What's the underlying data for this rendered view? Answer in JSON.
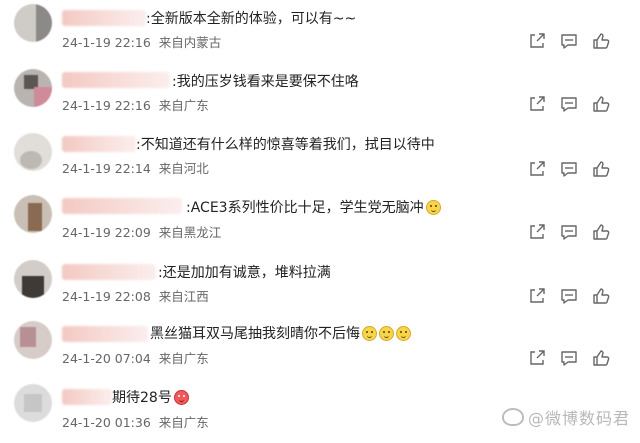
{
  "comments": [
    {
      "text": ":全新版本全新的体验，可以有~~",
      "date": "24-1-19 22:16",
      "source": "来自内蒙古",
      "emojis": []
    },
    {
      "text": ":我的压岁钱看来是要保不住咯",
      "date": "24-1-19 22:16",
      "source": "来自广东",
      "emojis": []
    },
    {
      "text": ":不知道还有什么样的惊喜等着我们，拭目以待中",
      "date": "24-1-19 22:14",
      "source": "来自河北",
      "emojis": []
    },
    {
      "text": ":ACE3系列性价比十足，学生党无脑冲",
      "date": "24-1-19 22:09",
      "source": "来自黑龙江",
      "emojis": [
        "smile-emoji"
      ]
    },
    {
      "text": ":还是加加有诚意，堆料拉满",
      "date": "24-1-19 22:08",
      "source": "来自江西",
      "emojis": []
    },
    {
      "text": "黑丝猫耳双马尾抽我刻晴你不后悔",
      "date": "24-1-20 07:04",
      "source": "来自广东",
      "emojis": [
        "smile-emoji",
        "smile-emoji",
        "smile-emoji"
      ]
    },
    {
      "text": "期待28号",
      "date": "24-1-20 01:36",
      "source": "来自广东",
      "emojis": [
        "heart-eyes-emoji"
      ]
    }
  ],
  "icons": {
    "share": "share-icon",
    "comment": "comment-icon",
    "like": "like-icon"
  },
  "watermark": "@微博数码君"
}
